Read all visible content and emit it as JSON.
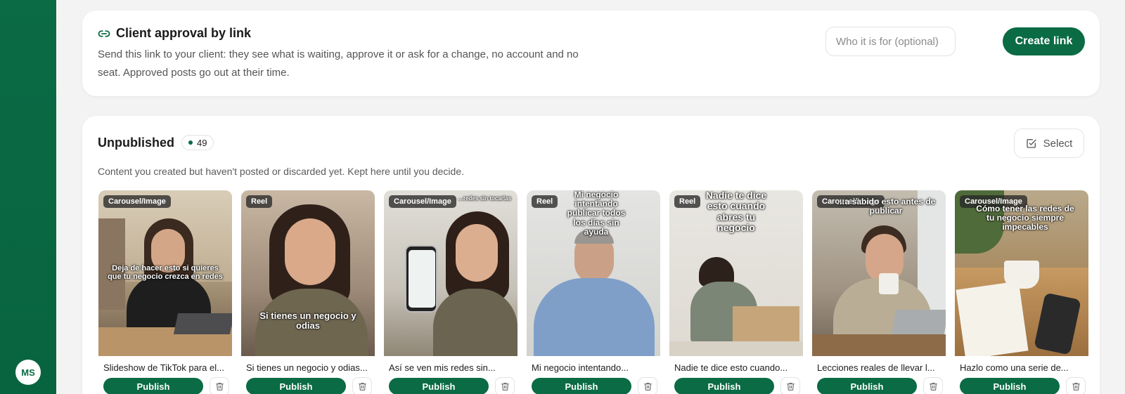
{
  "user": {
    "initials": "MS"
  },
  "approval": {
    "title": "Client approval by link",
    "description": "Send this link to your client: they see what is waiting, approve it or ask for a change, no account and no seat. Approved posts go out at their time.",
    "input_placeholder": "Who it is for (optional)",
    "input_value": "",
    "create_label": "Create link"
  },
  "unpublished": {
    "title": "Unpublished",
    "count": "49",
    "select_label": "Select",
    "description": "Content you created but haven't posted or discarded yet. Kept here until you decide.",
    "publish_label": "Publish",
    "posts": [
      {
        "tag": "Carousel/Image",
        "overlay": "Deja de hacer esto si quieres que tu negocio crezca en redes",
        "caption": "Slideshow de TikTok para el..."
      },
      {
        "tag": "Reel",
        "overlay": "Si tienes un negocio y odias",
        "caption": "Si tienes un negocio y odias..."
      },
      {
        "tag": "Carousel/Image",
        "overlay": "…redes sin tocarlas",
        "caption": "Así se ven mis redes sin..."
      },
      {
        "tag": "Reel",
        "overlay": "Mi negocio intentando publicar todos los días sin ayuda",
        "caption": "Mi negocio intentando..."
      },
      {
        "tag": "Reel",
        "overlay": "Nadie te dice esto cuando abres tu negocio",
        "caption": "Nadie te dice esto cuando..."
      },
      {
        "tag": "Carousel/Image",
        "overlay": "…a sabido esto antes de publicar",
        "caption": "Lecciones reales de llevar l..."
      },
      {
        "tag": "Carousel/Image",
        "overlay": "Cómo tener las redes de tu negocio siempre impecables",
        "caption": "Hazlo como una serie de..."
      }
    ]
  },
  "colors": {
    "brand": "#0a6b44",
    "sidebar": "#0b6b45"
  }
}
